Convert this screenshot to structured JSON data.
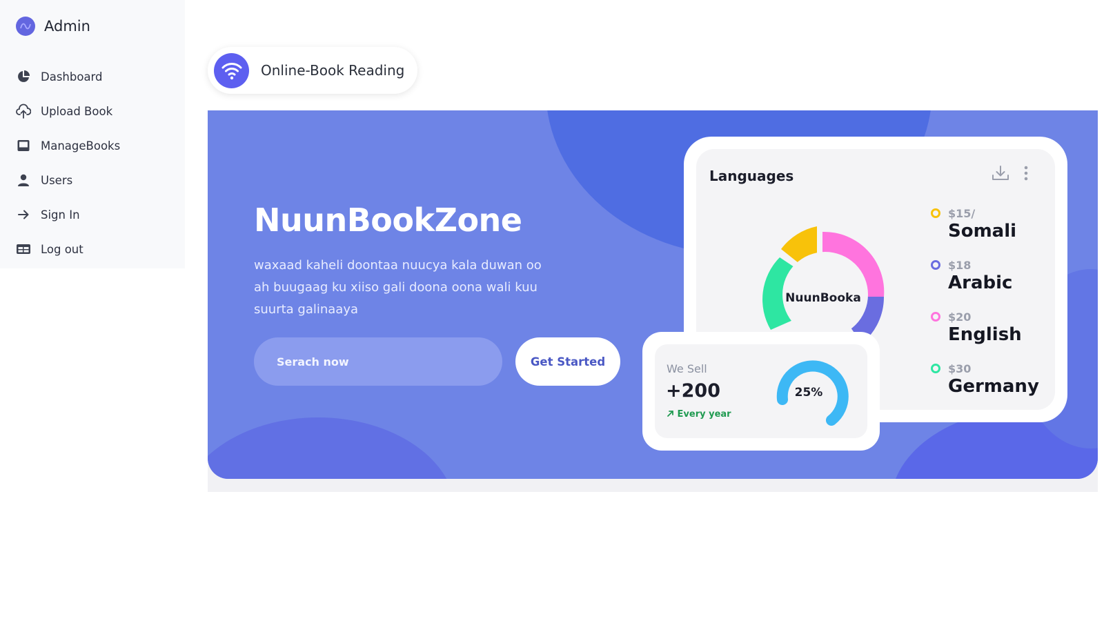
{
  "sidebar": {
    "brand": "Admin",
    "items": [
      {
        "label": "Dashboard",
        "icon": "pie-chart-icon"
      },
      {
        "label": "Upload Book",
        "icon": "cloud-upload-icon"
      },
      {
        "label": "ManageBooks",
        "icon": "inbox-icon"
      },
      {
        "label": "Users",
        "icon": "person-icon"
      },
      {
        "label": "Sign In",
        "icon": "arrow-right-icon"
      },
      {
        "label": "Log out",
        "icon": "table-icon"
      }
    ]
  },
  "header": {
    "title": "Online-Book Reading",
    "icon": "wifi-icon"
  },
  "hero": {
    "title": "NuunBookZone",
    "description": "waxaad kaheli doontaa  nuucya kala duwan oo ah buugaag ku xiiso gali doona oona wali kuu suurta galinaaya",
    "search_placeholder": "Serach now",
    "cta_label": "Get Started"
  },
  "languages_card": {
    "title": "Languages",
    "center_label": "NuunBooka",
    "items": [
      {
        "price": "$15/",
        "name": "Somali",
        "color": "#f8c20a"
      },
      {
        "price": "$18",
        "name": "Arabic",
        "color": "#6a6de0"
      },
      {
        "price": "$20",
        "name": "English",
        "color": "#ff74de"
      },
      {
        "price": "$30",
        "name": "Germany",
        "color": "#2ee6a2"
      }
    ]
  },
  "sell_card": {
    "label": "We Sell",
    "value": "+200",
    "trend": "Every year",
    "percent_label": "25%",
    "gauge_color": "#3db8f5"
  },
  "colors": {
    "brand": "#5d5ff0",
    "hero_bg": "#6e84e6"
  }
}
